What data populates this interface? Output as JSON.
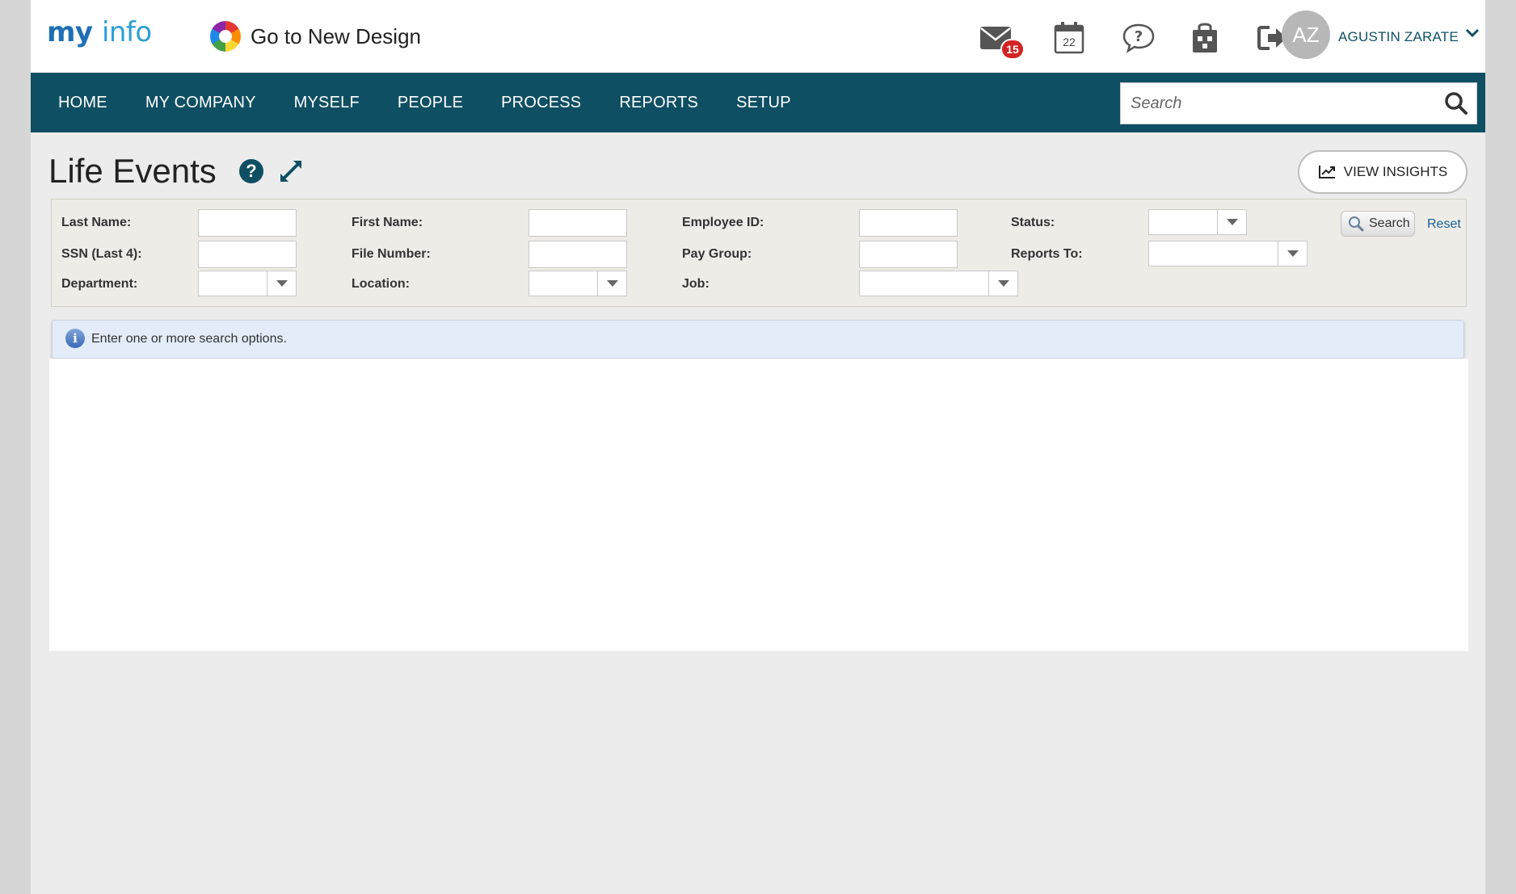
{
  "header": {
    "logo_my": "my",
    "logo_info": "info",
    "new_design_label": "Go to New Design",
    "mail_badge": "15",
    "calendar_day": "22",
    "avatar_initials": "AZ",
    "user_name": "AGUSTIN ZARATE"
  },
  "nav": {
    "items": [
      {
        "label": "HOME"
      },
      {
        "label": "MY COMPANY"
      },
      {
        "label": "MYSELF"
      },
      {
        "label": "PEOPLE"
      },
      {
        "label": "PROCESS"
      },
      {
        "label": "REPORTS"
      },
      {
        "label": "SETUP"
      }
    ],
    "search_placeholder": "Search"
  },
  "page": {
    "title": "Life Events",
    "insights_label": "VIEW INSIGHTS"
  },
  "filters": {
    "last_name": "Last Name:",
    "first_name": "First Name:",
    "employee_id": "Employee ID:",
    "status": "Status:",
    "ssn": "SSN (Last 4):",
    "file_number": "File Number:",
    "pay_group": "Pay Group:",
    "reports_to": "Reports To:",
    "department": "Department:",
    "location": "Location:",
    "job": "Job:",
    "search_label": "Search",
    "reset_label": "Reset"
  },
  "info": {
    "message": "Enter one or more search options."
  },
  "colors": {
    "nav_bg": "#0f4f63",
    "badge": "#d32222",
    "link": "#1a5e9c"
  }
}
